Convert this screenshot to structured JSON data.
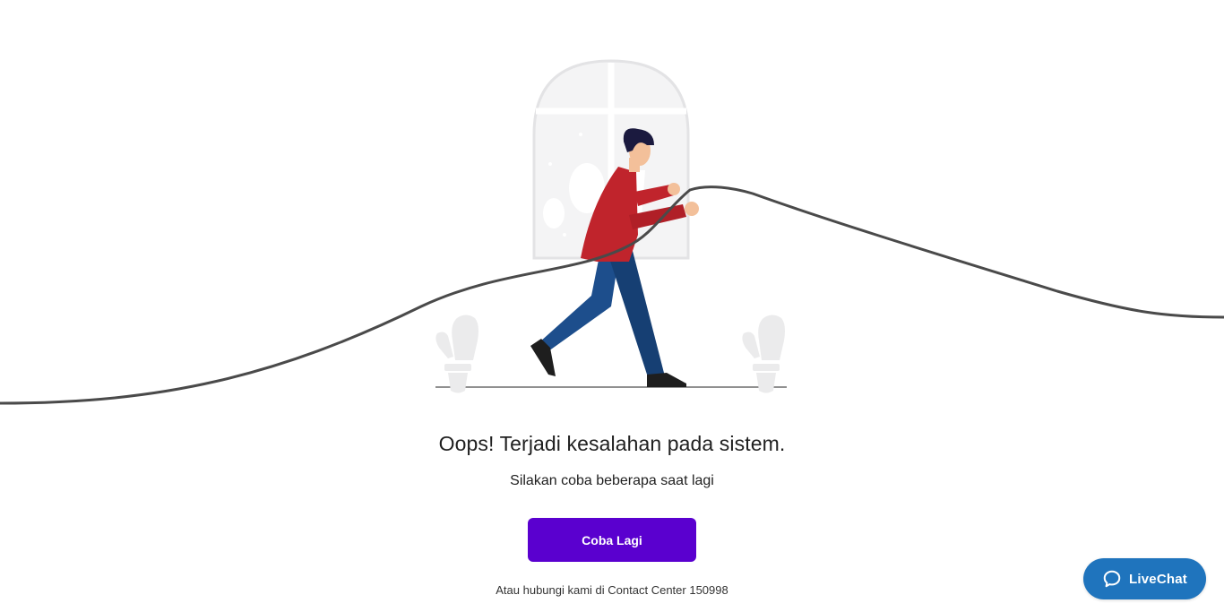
{
  "error": {
    "title": "Oops! Terjadi kesalahan pada sistem.",
    "subtitle": "Silakan coba beberapa saat lagi",
    "retry_label": "Coba Lagi",
    "contact_text": "Atau hubungi kami di Contact Center 150998"
  },
  "livechat": {
    "label": "LiveChat",
    "icon": "chat-bubble-icon"
  },
  "colors": {
    "primary_button": "#5a00cf",
    "livechat": "#1f74bd",
    "text": "#1f1f1f",
    "jacket": "#c0242c",
    "pants": "#1d4e8c"
  }
}
